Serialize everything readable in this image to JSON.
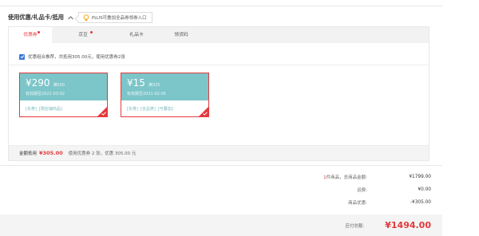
{
  "section": {
    "title": "使用优惠/礼品卡/抵用",
    "plus_tip": "PLUS可叠加全品券领券入口"
  },
  "tabs": [
    {
      "label": "优惠券",
      "active": true,
      "dot": true
    },
    {
      "label": "京豆",
      "active": false,
      "dot": true
    },
    {
      "label": "礼品卡",
      "active": false,
      "dot": false
    },
    {
      "label": "领货码",
      "active": false,
      "dot": false
    }
  ],
  "combo": {
    "checked": true,
    "text": "优惠组合推荐，共抵用305.00元，使用优惠券2张"
  },
  "coupons": [
    {
      "amount": "¥290",
      "condition": "满500",
      "expiry": "有效期至2021-03-02",
      "tags": [
        "[东券]",
        "[限店铺商品]"
      ],
      "selected": true
    },
    {
      "amount": "¥15",
      "condition": "满325",
      "expiry": "有效期至2021-02-05",
      "tags": [
        "[东券]",
        "[全品类]",
        "[可叠加]"
      ],
      "selected": true
    }
  ],
  "panel_footer": {
    "label": "金额抵用",
    "amount": "¥305.00",
    "desc": "使用优惠券 2 张，优惠 305.00 元"
  },
  "summary": {
    "item_count": "1",
    "items_label": "件商品，总商品金额:",
    "items_total": "¥1799.00",
    "shipping_label": "运费:",
    "shipping": "¥0.00",
    "discount_label": "商品优惠:",
    "discount": "-¥305.00",
    "payable_label": "应付总额:",
    "payable": "¥1494.00"
  },
  "colors": {
    "accent": "#e4393c",
    "coupon_bg": "#7cc5c9",
    "checkbox": "#3a76d8"
  }
}
